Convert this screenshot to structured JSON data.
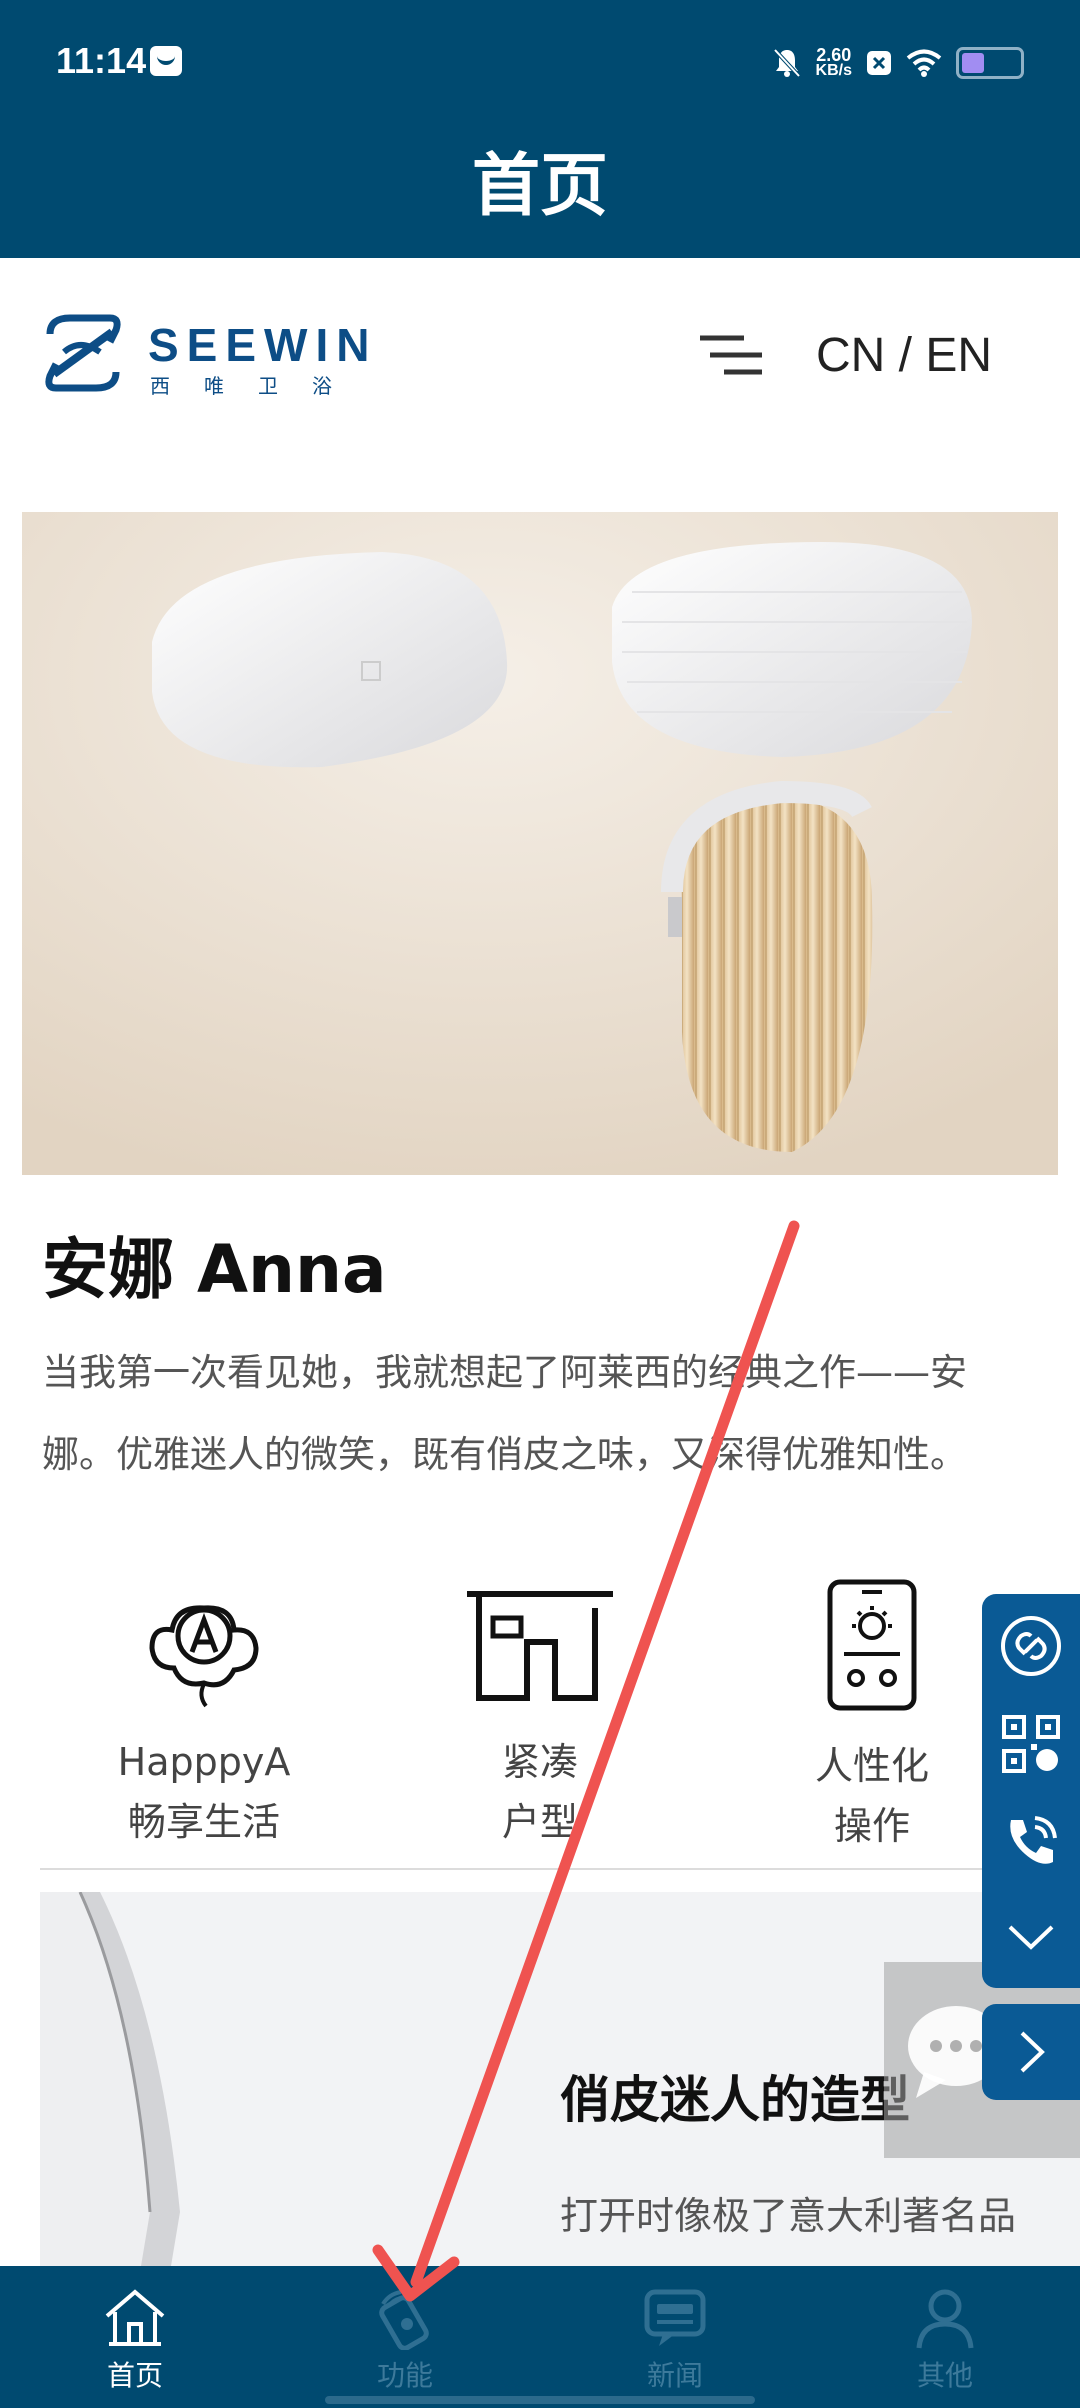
{
  "status_bar": {
    "time": "11:14",
    "net_speed_value": "2.60",
    "net_speed_unit": "KB/s"
  },
  "header": {
    "title": "首页"
  },
  "site": {
    "logo_word": "SEEWIN",
    "logo_cn": "西唯卫浴",
    "lang_switch": "CN / EN"
  },
  "product": {
    "title": "安娜 Anna",
    "description": "当我第一次看见她，我就想起了阿莱西的经典之作——安娜。优雅迷人的微笑，既有俏皮之味，又深得优雅知性。"
  },
  "features": [
    {
      "line1": "HapppyA",
      "line2": "畅享生活",
      "icon": "balloon-a-icon"
    },
    {
      "line1": "紧凑",
      "line2": "户型",
      "icon": "room-layout-icon"
    },
    {
      "line1": "人性化",
      "line2": "操作",
      "icon": "control-panel-icon"
    }
  ],
  "section2": {
    "title": "俏皮迷人的造型",
    "description": "打开时像极了意大利著名品"
  },
  "side_panel": [
    "link-icon",
    "qrcode-icon",
    "phone-icon",
    "chevron-down-icon",
    "chevron-right-icon"
  ],
  "bottom_nav": [
    {
      "label": "首页",
      "icon": "home-icon",
      "active": true
    },
    {
      "label": "功能",
      "icon": "remote-icon",
      "active": false
    },
    {
      "label": "新闻",
      "icon": "news-icon",
      "active": false
    },
    {
      "label": "其他",
      "icon": "user-icon",
      "active": false
    }
  ],
  "colors": {
    "primary": "#004a70",
    "brand": "#0d4d86",
    "annotation": "#ef5350"
  }
}
